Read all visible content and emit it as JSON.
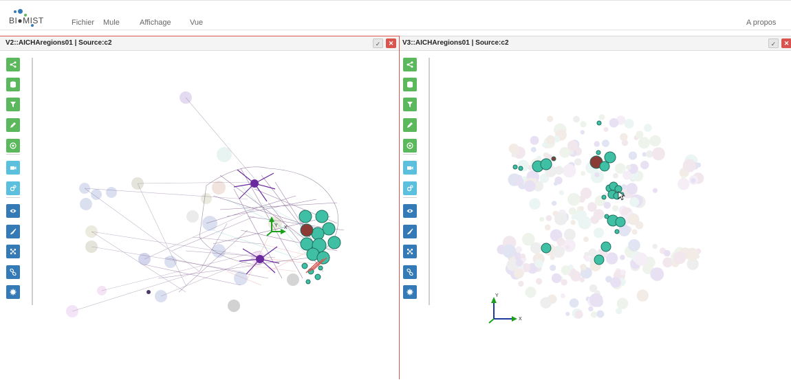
{
  "app": {
    "logo_text": "BI●MIST",
    "menu": [
      "Fichier",
      "Mule",
      "Affichage",
      "Vue"
    ],
    "about": "A propos"
  },
  "panels": [
    {
      "title": "V2::AICHAregions01 | Source:c2",
      "active": true
    },
    {
      "title": "V3::AICHAregions01 | Source:c2",
      "active": false
    }
  ],
  "toolbar": {
    "buttons": [
      {
        "icon": "share-icon",
        "color": "green"
      },
      {
        "icon": "database-icon",
        "color": "green"
      },
      {
        "icon": "filter-icon",
        "color": "green"
      },
      {
        "icon": "pencil-icon",
        "color": "green"
      },
      {
        "icon": "target-icon",
        "color": "green"
      },
      {
        "icon": "video-camera-icon",
        "color": "cyan"
      },
      {
        "icon": "cogs-icon",
        "color": "cyan"
      },
      {
        "icon": "eye-icon",
        "color": "blue"
      },
      {
        "icon": "brush-icon",
        "color": "blue"
      },
      {
        "icon": "expand-icon",
        "color": "blue"
      },
      {
        "icon": "link-icon",
        "color": "blue"
      },
      {
        "icon": "gear-icon",
        "color": "blue"
      }
    ]
  },
  "axes": {
    "x": "X",
    "y": "Y",
    "z": "Z"
  },
  "colors": {
    "accent_red": "#d9534f",
    "green": "#5cb85c",
    "cyan": "#5bc0de",
    "blue": "#337ab7",
    "node_teal": "#3fbfa4",
    "node_brown": "#8b3a36",
    "edge_purple": "#6a2a9e"
  }
}
